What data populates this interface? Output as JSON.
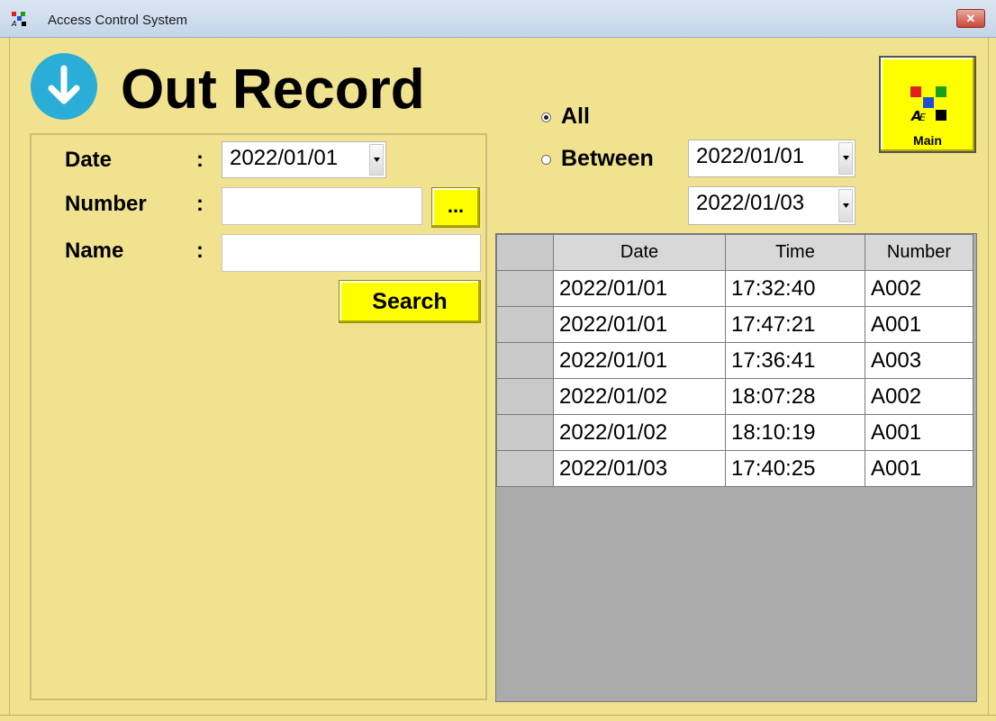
{
  "window": {
    "title": "Access Control System",
    "close_label": "✕"
  },
  "page": {
    "title": "Out Record"
  },
  "filters": {
    "date_label": "Date",
    "date_value": "2022/01/01",
    "number_label": "Number",
    "number_value": "",
    "browse_label": "...",
    "name_label": "Name",
    "name_value": "",
    "colon": ":",
    "search_label": "Search"
  },
  "range": {
    "all_label": "All",
    "between_label": "Between",
    "selected": "All",
    "from_date": "2022/01/01",
    "to_date": "2022/01/03"
  },
  "main_button": {
    "label": "Main"
  },
  "table": {
    "columns": [
      "Date",
      "Time",
      "Number"
    ],
    "rows": [
      [
        "2022/01/01",
        "17:32:40",
        "A002"
      ],
      [
        "2022/01/01",
        "17:47:21",
        "A001"
      ],
      [
        "2022/01/01",
        "17:36:41",
        "A003"
      ],
      [
        "2022/01/02",
        "18:07:28",
        "A002"
      ],
      [
        "2022/01/02",
        "18:10:19",
        "A001"
      ],
      [
        "2022/01/03",
        "17:40:25",
        "A001"
      ]
    ]
  },
  "colors": {
    "background": "#f0e28f",
    "accent_button": "#ffff00",
    "icon_circle": "#2aaed8",
    "grid_empty": "#ababab"
  }
}
